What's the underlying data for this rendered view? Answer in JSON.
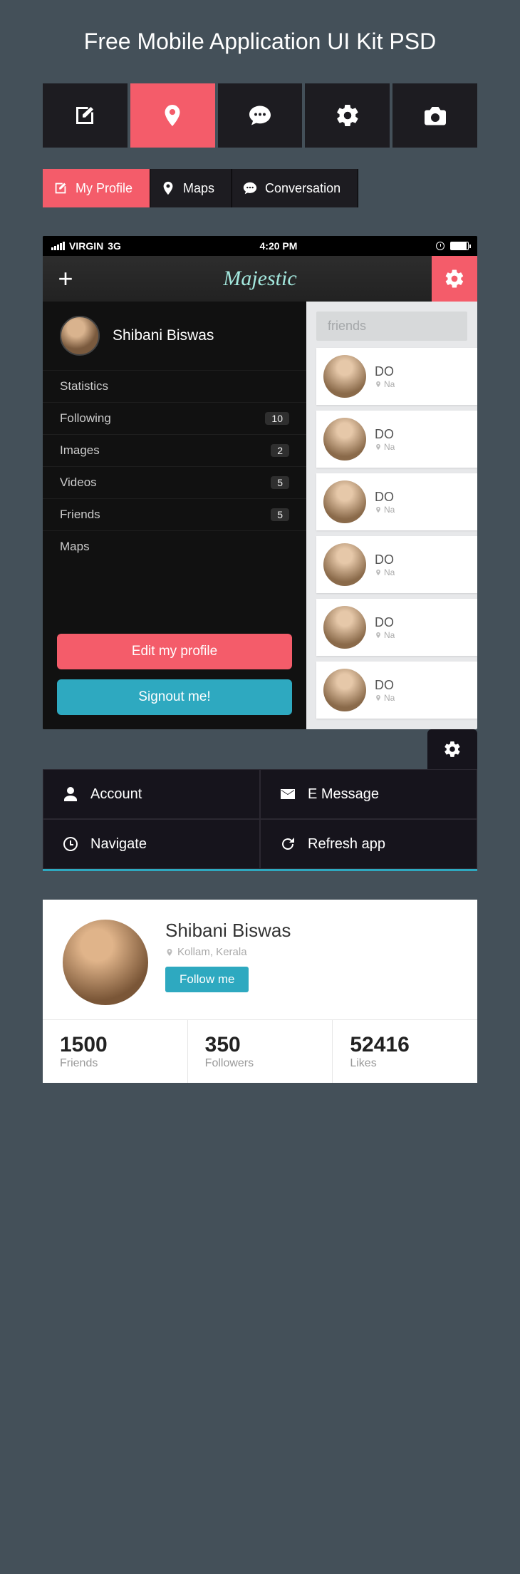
{
  "page_title": "Free Mobile Application UI Kit PSD",
  "iconbar2": {
    "profile": "My Profile",
    "maps": "Maps",
    "conversation": "Conversation"
  },
  "phone": {
    "carrier": "VIRGIN",
    "network": "3G",
    "time": "4:20 PM",
    "app_title": "Majestic",
    "sidebar": {
      "user_name": "Shibani Biswas",
      "items": [
        {
          "label": "Statistics",
          "badge": null
        },
        {
          "label": "Following",
          "badge": "10"
        },
        {
          "label": "Images",
          "badge": "2"
        },
        {
          "label": "Videos",
          "badge": "5"
        },
        {
          "label": "Friends",
          "badge": "5"
        },
        {
          "label": "Maps",
          "badge": null
        }
      ],
      "edit_label": "Edit my profile",
      "signout_label": "Signout me!"
    },
    "rightpane": {
      "search_placeholder": "friends",
      "cards": [
        {
          "name": "DO",
          "loc": "Na"
        },
        {
          "name": "DO",
          "loc": "Na"
        },
        {
          "name": "DO",
          "loc": "Na"
        },
        {
          "name": "DO",
          "loc": "Na"
        },
        {
          "name": "DO",
          "loc": "Na"
        },
        {
          "name": "DO",
          "loc": "Na"
        }
      ]
    }
  },
  "gridmenu": {
    "account": "Account",
    "emessage": "E Message",
    "navigate": "Navigate",
    "refresh": "Refresh app"
  },
  "profile_card": {
    "name": "Shibani Biswas",
    "location": "Kollam, Kerala",
    "follow_label": "Follow me",
    "stats": [
      {
        "num": "1500",
        "lbl": "Friends"
      },
      {
        "num": "350",
        "lbl": "Followers"
      },
      {
        "num": "52416",
        "lbl": "Likes"
      }
    ]
  }
}
